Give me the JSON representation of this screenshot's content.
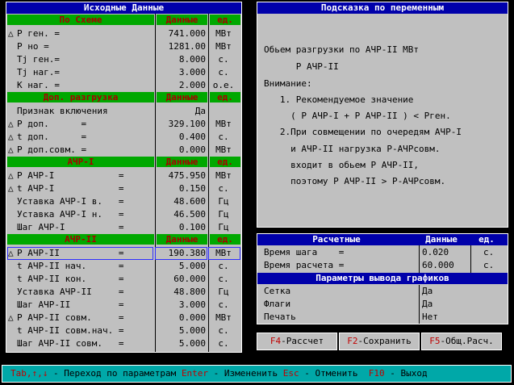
{
  "left_panel": {
    "title": "Исходные Данные",
    "sections": [
      {
        "header": {
          "name": "По Схеме",
          "value": "Данные",
          "unit": "ед."
        },
        "rows": [
          {
            "mark": "△",
            "name": "P ген. =",
            "value": "741.000",
            "unit": "МВт"
          },
          {
            "mark": "",
            "name": "P но =",
            "value": "1281.00",
            "unit": "МВт"
          },
          {
            "mark": "",
            "name": "Tj ген.=",
            "value": "8.000",
            "unit": "с."
          },
          {
            "mark": "",
            "name": "Tj наг.=",
            "value": "3.000",
            "unit": "с."
          },
          {
            "mark": "",
            "name": "K наг. =",
            "value": "2.000",
            "unit": "о.е."
          }
        ]
      },
      {
        "header": {
          "name": "Доп. разгрузка",
          "value": "Данные",
          "unit": "ед."
        },
        "rows": [
          {
            "mark": "",
            "name": "Признак включения",
            "value": "Да",
            "unit": ""
          },
          {
            "mark": "△",
            "name": "P доп.      =",
            "value": "329.100",
            "unit": "МВт"
          },
          {
            "mark": "△",
            "name": "t доп.      =",
            "value": "0.400",
            "unit": "с."
          },
          {
            "mark": "△",
            "name": "P доп.совм. =",
            "value": "0.000",
            "unit": "МВт"
          }
        ]
      },
      {
        "header": {
          "name": "АЧР-I",
          "value": "Данные",
          "unit": "ед."
        },
        "rows": [
          {
            "mark": "△",
            "name": "P АЧР-I            =",
            "value": "475.950",
            "unit": "МВт"
          },
          {
            "mark": "△",
            "name": "t АЧР-I            =",
            "value": "0.150",
            "unit": "с."
          },
          {
            "mark": "",
            "name": "Уставка АЧР-I в.   =",
            "value": "48.600",
            "unit": "Гц"
          },
          {
            "mark": "",
            "name": "Уставка АЧР-I н.   =",
            "value": "46.500",
            "unit": "Гц"
          },
          {
            "mark": "",
            "name": "Шаг АЧР-I          =",
            "value": "0.100",
            "unit": "Гц"
          }
        ]
      },
      {
        "header": {
          "name": "АЧР-II",
          "value": "Данные",
          "unit": "ед."
        },
        "rows": [
          {
            "mark": "△",
            "name": "P АЧР-II           =",
            "value": "190.380",
            "unit": "МВт"
          },
          {
            "mark": "",
            "name": "t АЧР-II нач.      =",
            "value": "5.000",
            "unit": "с."
          },
          {
            "mark": "",
            "name": "t АЧР-II кон.      =",
            "value": "60.000",
            "unit": "с."
          },
          {
            "mark": "",
            "name": "Уставка АЧР-II     =",
            "value": "48.800",
            "unit": "Гц"
          },
          {
            "mark": "",
            "name": "Шаг АЧР-II         =",
            "value": "3.000",
            "unit": "с."
          },
          {
            "mark": "△",
            "name": "P АЧР-II совм.     =",
            "value": "0.000",
            "unit": "МВт"
          },
          {
            "mark": "",
            "name": "t АЧР-II совм.нач. =",
            "value": "5.000",
            "unit": "с."
          },
          {
            "mark": "",
            "name": "Шаг АЧР-II совм.   =",
            "value": "5.000",
            "unit": "с."
          }
        ]
      }
    ]
  },
  "hint_panel": {
    "title": "Подсказка по переменным",
    "lines": [
      "Обьем разгрузки по АЧР-II МВт",
      "      P АЧР-II",
      "Внимание:",
      "   1. Рекомендуемое значение",
      "     ( P АЧР-I + P АЧР-II ) < Pген.",
      "   2.При совмещении по очередям АЧР-I",
      "     и АЧР-II нагрузка P-АЧРсовм.",
      "     входит в обьем P АЧР-II,",
      "     поэтому P АЧР-II > P-АЧРсовм."
    ]
  },
  "calc_panel": {
    "header": {
      "name": "Расчетные",
      "value": "Данные",
      "unit": "ед."
    },
    "rows": [
      {
        "name": "Время шага    =",
        "value": "0.020",
        "unit": "с."
      },
      {
        "name": "Время расчета =",
        "value": "60.000",
        "unit": "с."
      }
    ],
    "graph_header": "Параметры вывода графиков",
    "graph_rows": [
      {
        "name": "Сетка",
        "value": "Да"
      },
      {
        "name": "Флаги",
        "value": "Да"
      },
      {
        "name": "Печать",
        "value": "Нет"
      }
    ]
  },
  "buttons": [
    {
      "key": "F4",
      "label": "-Рассчет"
    },
    {
      "key": "F2",
      "label": "-Сохранить"
    },
    {
      "key": "F5",
      "label": "-Общ.Расч."
    }
  ],
  "status_bar": [
    {
      "k": "Tab,↑,↓",
      "t": " - Переход по параметрам "
    },
    {
      "k": "Enter",
      "t": " - Измененить "
    },
    {
      "k": "Esc",
      "t": " - Отменить  "
    },
    {
      "k": "F10",
      "t": " - Выход"
    }
  ],
  "colors": {
    "accent_title": "#0000aa",
    "section_bg": "#00a800",
    "section_text": "#a80000",
    "status_bg": "#00a8a8",
    "highlight": "#3030ff"
  }
}
